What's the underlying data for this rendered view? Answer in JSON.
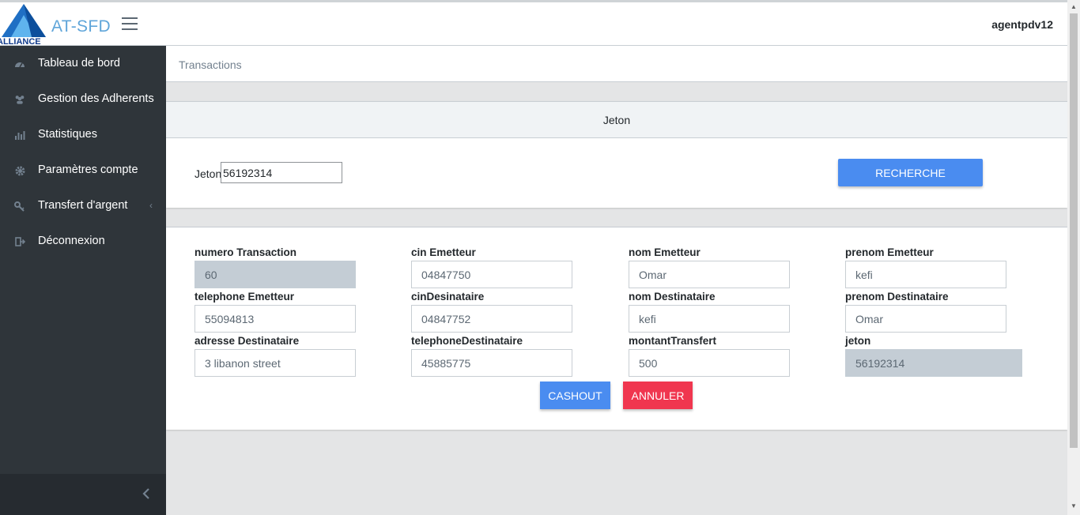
{
  "brand": {
    "logo_text": "ALLIANCE",
    "name": "AT-SFD"
  },
  "user": {
    "name": "agentpdv12"
  },
  "sidebar": {
    "items": [
      {
        "label": "Tableau de bord",
        "icon": "speedometer-icon"
      },
      {
        "label": "Gestion des Adherents",
        "icon": "people-icon"
      },
      {
        "label": "Statistiques",
        "icon": "chart-icon"
      },
      {
        "label": "Paramètres compte",
        "icon": "gear-icon"
      },
      {
        "label": "Transfert d'argent",
        "icon": "key-icon",
        "arrow": "‹"
      },
      {
        "label": "Déconnexion",
        "icon": "logout-icon"
      }
    ]
  },
  "breadcrumb": {
    "current": "Transactions"
  },
  "search_card": {
    "header": "Jeton",
    "label": "Jeton",
    "value": "56192314",
    "button": "RECHERCHE"
  },
  "details": {
    "fields": [
      {
        "label": "numero Transaction",
        "value": "60"
      },
      {
        "label": "cin Emetteur",
        "value": "04847750"
      },
      {
        "label": "nom Emetteur",
        "value": "Omar"
      },
      {
        "label": "prenom Emetteur",
        "value": "kefi"
      },
      {
        "label": "telephone Emetteur",
        "value": "55094813"
      },
      {
        "label": "cinDesinataire",
        "value": "04847752"
      },
      {
        "label": "nom Destinataire",
        "value": "kefi"
      },
      {
        "label": "prenom Destinataire",
        "value": "Omar"
      },
      {
        "label": "adresse Destinataire",
        "value": "3 libanon street"
      },
      {
        "label": "telephoneDestinataire",
        "value": "45885775"
      },
      {
        "label": "montantTransfert",
        "value": "500"
      },
      {
        "label": "jeton",
        "value": "56192314"
      }
    ],
    "cashout_button": "CASHOUT",
    "cancel_button": "ANNULER"
  },
  "colors": {
    "primary": "#4a8cf0",
    "danger": "#f0364f",
    "sidebar": "#2f353a",
    "brand": "#5fa5d9"
  }
}
